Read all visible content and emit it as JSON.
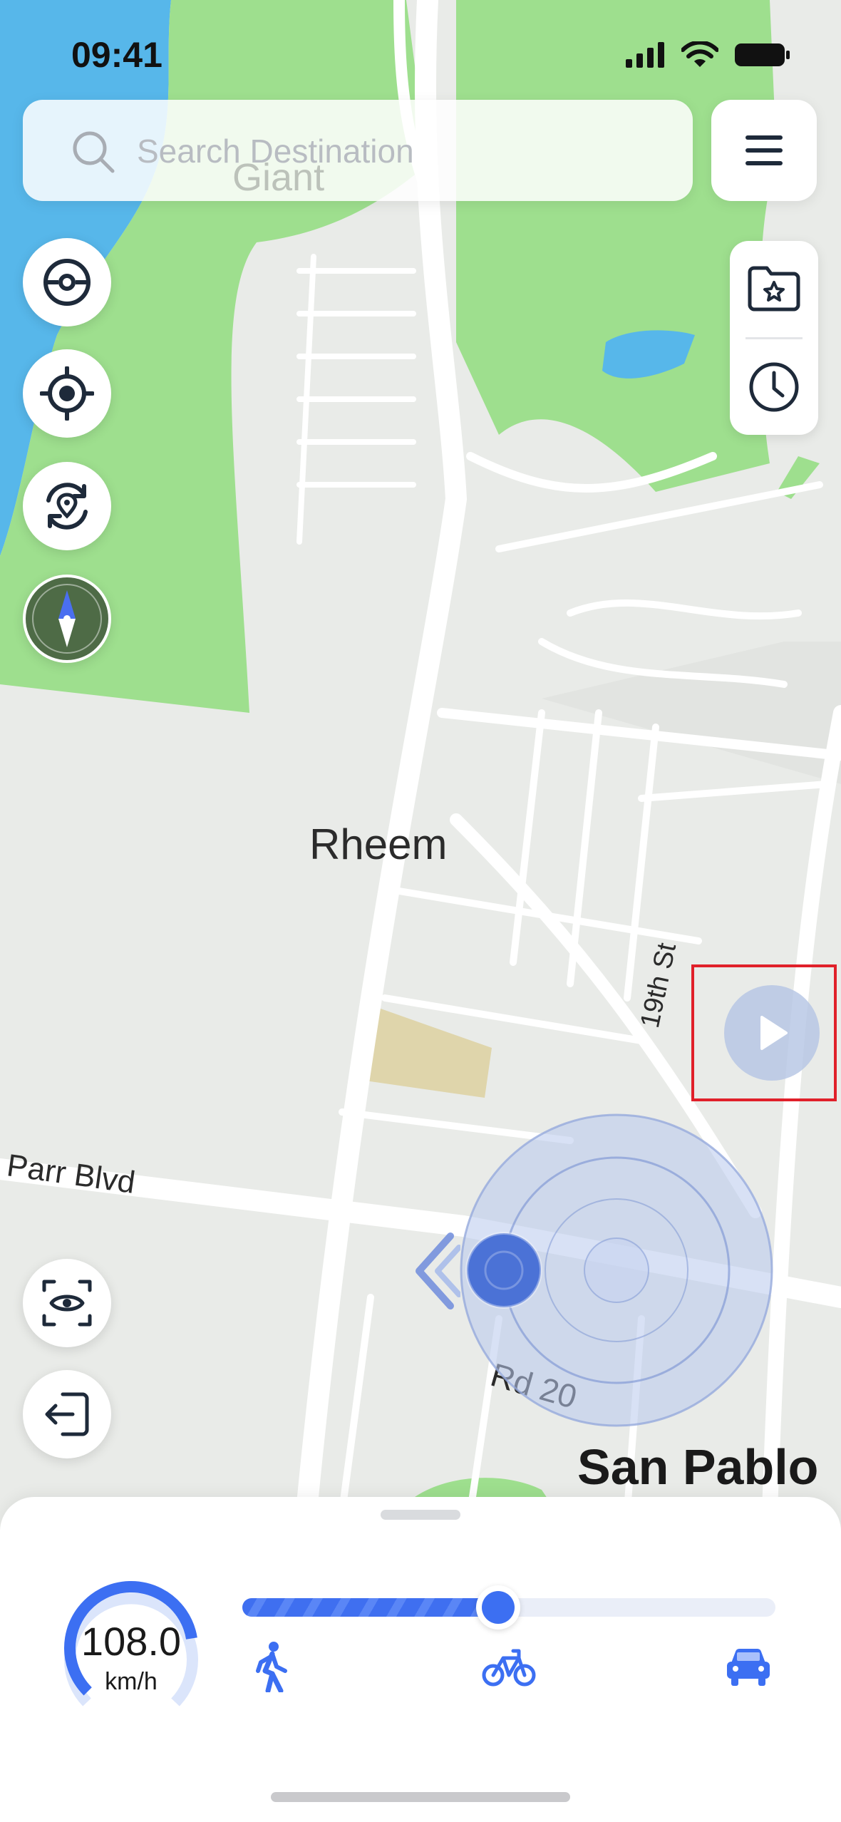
{
  "status_bar": {
    "time": "09:41"
  },
  "search": {
    "placeholder": "Search Destination"
  },
  "map": {
    "labels": {
      "giant": "Giant",
      "rheem": "Rheem",
      "parr_blvd": "Parr Blvd",
      "nineteenth_st": "19th St",
      "rd_20": "Rd 20",
      "san_pablo": "San Pablo"
    }
  },
  "toolbar_left": [
    "pokeball-icon",
    "locate-target-icon",
    "location-refresh-icon",
    "compass-icon"
  ],
  "toolbar_right": [
    "favorites-folder-icon",
    "history-clock-icon"
  ],
  "bottom_left": [
    "scan-eye-icon",
    "exit-icon"
  ],
  "speed": {
    "value": "108.0",
    "unit": "km/h",
    "slider_fraction": 0.48,
    "modes": [
      "walk",
      "bike",
      "car"
    ]
  },
  "colors": {
    "accent": "#3c6ff2",
    "water": "#57b7ea",
    "park": "#9edf8e",
    "highlight": "#e0202a",
    "compass_bg": "#4e6b46"
  }
}
